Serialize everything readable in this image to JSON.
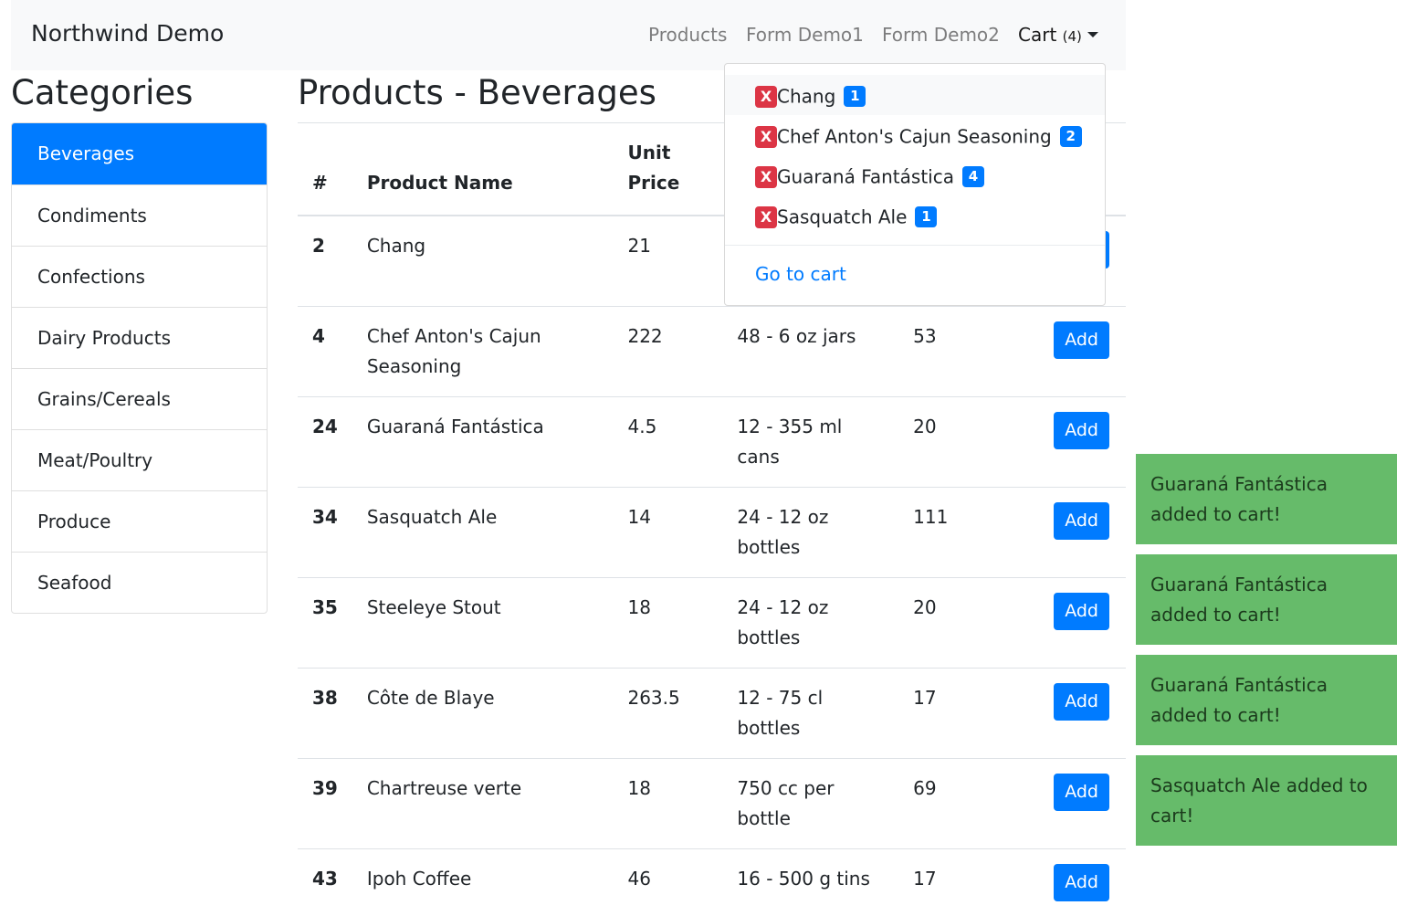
{
  "navbar": {
    "brand": "Northwind Demo",
    "links": [
      "Products",
      "Form Demo1",
      "Form Demo2"
    ],
    "cart_label": "Cart",
    "cart_count": "(4)"
  },
  "categories": {
    "title": "Categories",
    "items": [
      "Beverages",
      "Condiments",
      "Confections",
      "Dairy Products",
      "Grains/Cereals",
      "Meat/Poultry",
      "Produce",
      "Seafood"
    ],
    "active": "Beverages"
  },
  "products": {
    "title": "Products - Beverages",
    "headers": [
      "#",
      "Product Name",
      "Unit Price"
    ],
    "add_label": "Add",
    "rows": [
      {
        "id": "2",
        "name": "Chang",
        "price": "21",
        "qty": "",
        "stock": ""
      },
      {
        "id": "4",
        "name": "Chef Anton's Cajun Seasoning",
        "price": "222",
        "qty": "48 - 6 oz jars",
        "stock": "53"
      },
      {
        "id": "24",
        "name": "Guaraná Fantástica",
        "price": "4.5",
        "qty": "12 - 355 ml cans",
        "stock": "20"
      },
      {
        "id": "34",
        "name": "Sasquatch Ale",
        "price": "14",
        "qty": "24 - 12 oz bottles",
        "stock": "111"
      },
      {
        "id": "35",
        "name": "Steeleye Stout",
        "price": "18",
        "qty": "24 - 12 oz bottles",
        "stock": "20"
      },
      {
        "id": "38",
        "name": "Côte de Blaye",
        "price": "263.5",
        "qty": "12 - 75 cl bottles",
        "stock": "17"
      },
      {
        "id": "39",
        "name": "Chartreuse verte",
        "price": "18",
        "qty": "750 cc per bottle",
        "stock": "69"
      },
      {
        "id": "43",
        "name": "Ipoh Coffee",
        "price": "46",
        "qty": "16 - 500 g tins",
        "stock": "17"
      }
    ]
  },
  "cart_dropdown": {
    "remove_label": "X",
    "items": [
      {
        "name": "Chang",
        "qty": "1"
      },
      {
        "name": "Chef Anton's Cajun Seasoning",
        "qty": "2"
      },
      {
        "name": "Guaraná Fantástica",
        "qty": "4"
      },
      {
        "name": "Sasquatch Ale",
        "qty": "1"
      }
    ],
    "go_to_cart": "Go to cart"
  },
  "toasts": [
    "Guaraná Fantástica added to cart!",
    "Guaraná Fantástica added to cart!",
    "Guaraná Fantástica added to cart!",
    "Sasquatch Ale added to cart!"
  ],
  "colors": {
    "primary": "#007bff",
    "danger": "#dc3545",
    "toast_bg": "#66bb6a",
    "navbar_bg": "#f8f9fa"
  }
}
